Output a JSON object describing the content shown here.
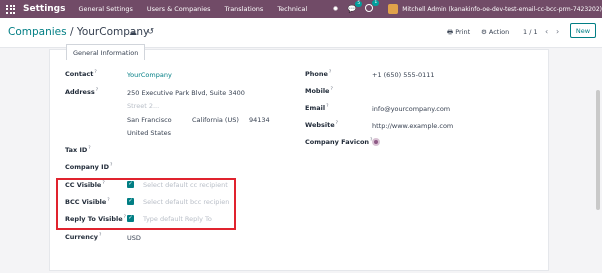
{
  "navbar": {
    "brand": "Settings",
    "menu": [
      "General Settings",
      "Users & Companies",
      "Translations",
      "Technical"
    ],
    "chat_badge": "5",
    "activity_badge": "1",
    "user": "Mitchell Admin (kanakinfo-oe-dev-test-email-cc-bcc-prm-7423202)"
  },
  "control": {
    "breadcrumb_parent": "Companies",
    "breadcrumb_sep": "/",
    "breadcrumb_current": "YourCompany",
    "print": "Print",
    "action": "Action",
    "pager": "1 / 1",
    "new": "New"
  },
  "tab": "General Information",
  "form": {
    "contact_label": "Contact",
    "contact_value": "YourCompany",
    "address_label": "Address",
    "street": "250 Executive Park Blvd, Suite 3400",
    "street2_placeholder": "Street 2...",
    "city": "San Francisco",
    "state": "California (US)",
    "zip": "94134",
    "country": "United States",
    "tax_id_label": "Tax ID",
    "company_id_label": "Company ID",
    "cc_label": "CC Visible",
    "cc_placeholder": "Select default cc recipient",
    "bcc_label": "BCC Visible",
    "bcc_placeholder": "Select default bcc recipien",
    "reply_label": "Reply To Visible",
    "reply_placeholder": "Type default Reply To",
    "currency_label": "Currency",
    "currency_value": "USD",
    "phone_label": "Phone",
    "phone_value": "+1 (650) 555-0111",
    "mobile_label": "Mobile",
    "email_label": "Email",
    "email_value": "info@yourcompany.com",
    "website_label": "Website",
    "website_value": "http://www.example.com",
    "favicon_label": "Company Favicon",
    "help_mark": "?"
  },
  "colors": {
    "navbar": "#714b67",
    "accent": "#017e84",
    "highlight": "#e0232e"
  }
}
